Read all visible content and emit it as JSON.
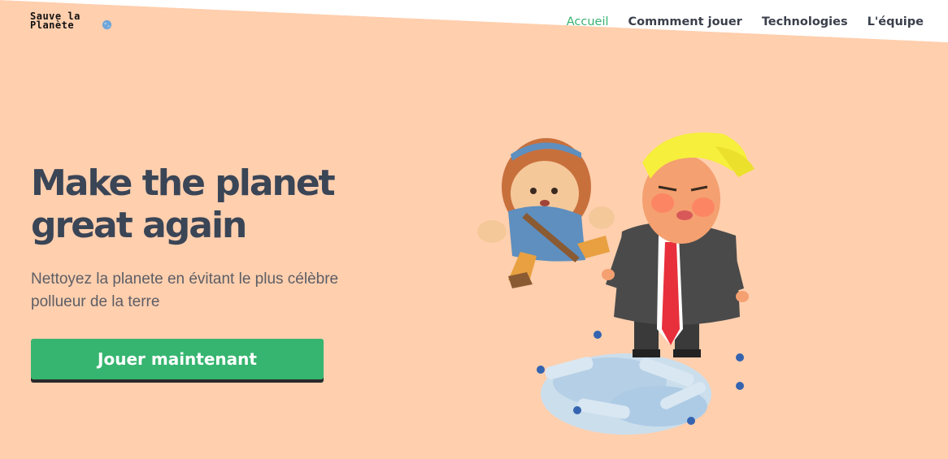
{
  "brand": {
    "line1": "Sauve la",
    "line2": "Planète"
  },
  "nav": {
    "items": [
      {
        "label": "Accueil",
        "active": true
      },
      {
        "label": "Commment jouer",
        "active": false
      },
      {
        "label": "Technologies",
        "active": false
      },
      {
        "label": "L'équipe",
        "active": false
      }
    ]
  },
  "hero": {
    "title_line1": "Make the planet",
    "title_line2": "great again",
    "subtitle": "Nettoyez la planete en évitant le plus célèbre pollueur de la terre",
    "cta_label": "Jouer maintenant"
  },
  "colors": {
    "hero_background": "#ffcfae",
    "accent_green": "#36b570",
    "heading": "#3a4556"
  },
  "icons": {
    "logo": "globe-icon"
  }
}
